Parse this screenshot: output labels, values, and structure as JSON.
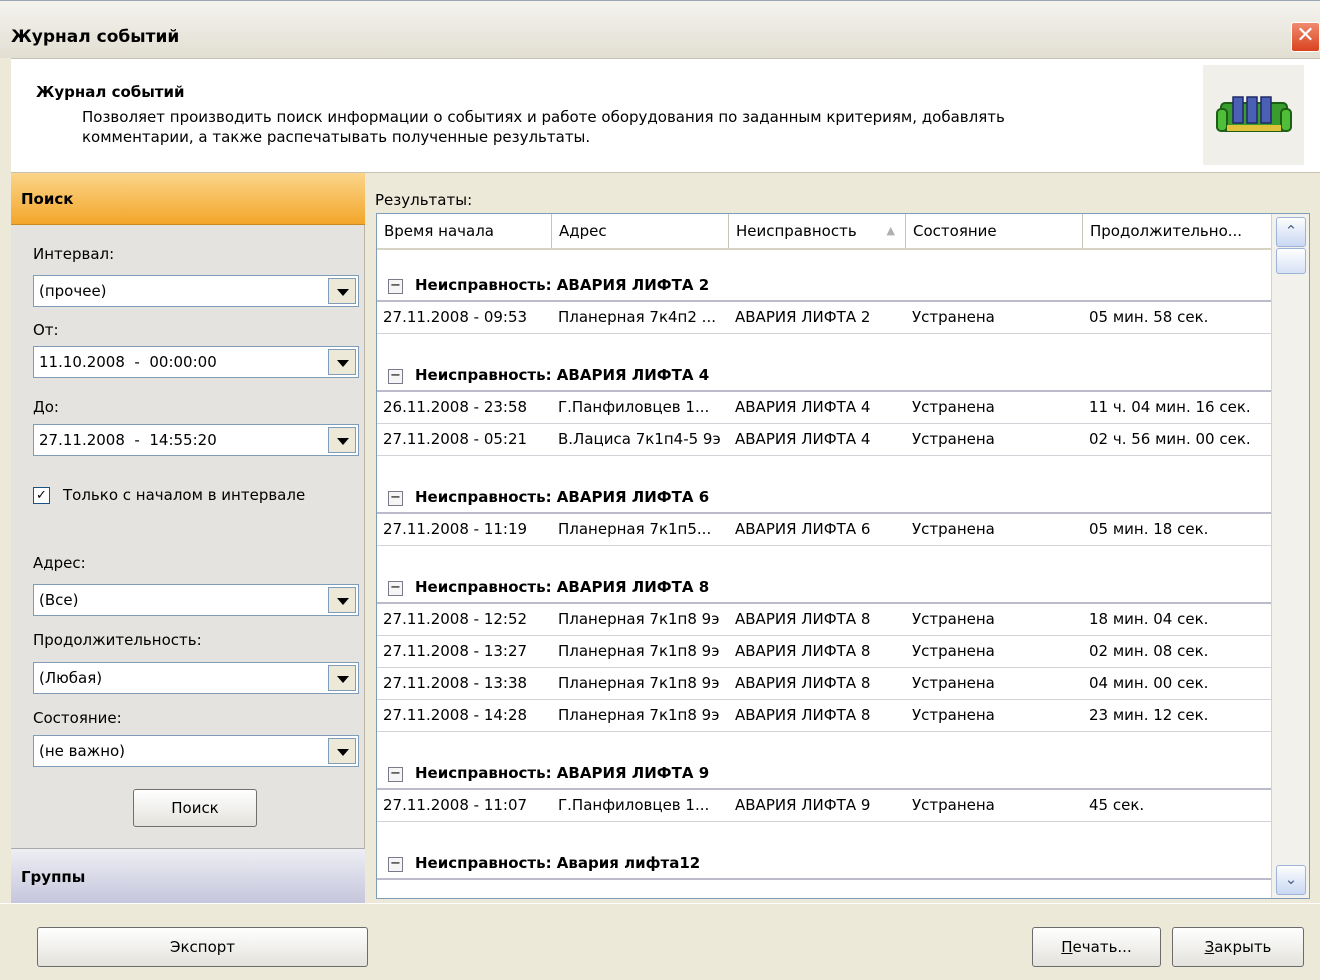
{
  "window": {
    "title": "Журнал событий",
    "close_glyph": "✕"
  },
  "header": {
    "title": "Журнал событий",
    "description_line1": "Позволяет производить поиск информации о событиях и работе оборудования по заданным критериям, добавлять",
    "description_line2": "комментарии, а также распечатывать полученные результаты.",
    "icon": "memory-module-icon"
  },
  "search_panel": {
    "heading": "Поиск",
    "interval_label": "Интервал:",
    "interval_value": "(прочее)",
    "from_label": "От:",
    "from_value": "11.10.2008  -  00:00:00",
    "to_label": "До:",
    "to_value": "27.11.2008  -  14:55:20",
    "only_start_checkbox_label": "Только с началом в интервале",
    "only_start_checked": true,
    "address_label": "Адрес:",
    "address_value": "(Все)",
    "duration_label": "Продолжительность:",
    "duration_value": "(Любая)",
    "state_label": "Состояние:",
    "state_value": "(не важно)",
    "search_button": "Поиск",
    "groups_heading": "Группы"
  },
  "results": {
    "label": "Результаты:",
    "columns": [
      "Время начала",
      "Адрес",
      "Неисправность",
      "Состояние",
      "Продолжительно..."
    ],
    "groups": [
      {
        "title": "Неисправность: АВАРИЯ ЛИФТА 2",
        "rows": [
          [
            "27.11.2008 - 09:53",
            "Планерная 7к4п2 ...",
            "АВАРИЯ ЛИФТА 2",
            "Устранена",
            "05 мин. 58 сек."
          ]
        ]
      },
      {
        "title": "Неисправность: АВАРИЯ ЛИФТА 4",
        "rows": [
          [
            "26.11.2008 - 23:58",
            "Г.Панфиловцев 1...",
            "АВАРИЯ ЛИФТА 4",
            "Устранена",
            "11 ч. 04 мин. 16 сек."
          ],
          [
            "27.11.2008 - 05:21",
            "В.Лациса 7к1п4-5 9э",
            "АВАРИЯ ЛИФТА 4",
            "Устранена",
            "02 ч. 56 мин. 00 сек."
          ]
        ]
      },
      {
        "title": "Неисправность: АВАРИЯ ЛИФТА 6",
        "rows": [
          [
            "27.11.2008 - 11:19",
            "Планерная 7к1п5...",
            "АВАРИЯ ЛИФТА 6",
            "Устранена",
            "05 мин. 18 сек."
          ]
        ]
      },
      {
        "title": "Неисправность: АВАРИЯ ЛИФТА 8",
        "rows": [
          [
            "27.11.2008 - 12:52",
            "Планерная 7к1п8 9э",
            "АВАРИЯ ЛИФТА 8",
            "Устранена",
            "18 мин. 04 сек."
          ],
          [
            "27.11.2008 - 13:27",
            "Планерная 7к1п8 9э",
            "АВАРИЯ ЛИФТА 8",
            "Устранена",
            "02 мин. 08 сек."
          ],
          [
            "27.11.2008 - 13:38",
            "Планерная 7к1п8 9э",
            "АВАРИЯ ЛИФТА 8",
            "Устранена",
            "04 мин. 00 сек."
          ],
          [
            "27.11.2008 - 14:28",
            "Планерная 7к1п8 9э",
            "АВАРИЯ ЛИФТА 8",
            "Устранена",
            "23 мин. 12 сек."
          ]
        ]
      },
      {
        "title": "Неисправность: АВАРИЯ ЛИФТА 9",
        "rows": [
          [
            "27.11.2008 - 11:07",
            "Г.Панфиловцев 1...",
            "АВАРИЯ ЛИФТА 9",
            "Устранена",
            "45 сек."
          ]
        ]
      },
      {
        "title": "Неисправность: Авария лифта12",
        "rows": []
      }
    ],
    "sort_indicator_icon": "sort-ascending-icon"
  },
  "footer": {
    "export_button": "Экспорт",
    "print_button_hotkey": "П",
    "print_button_rest": "ечать...",
    "close_button_hotkey": "З",
    "close_button_rest": "акрыть"
  },
  "colors": {
    "search_header": "#f3a62a",
    "groups_header": "#c5c6dc",
    "window_bg": "#ece9d8"
  }
}
